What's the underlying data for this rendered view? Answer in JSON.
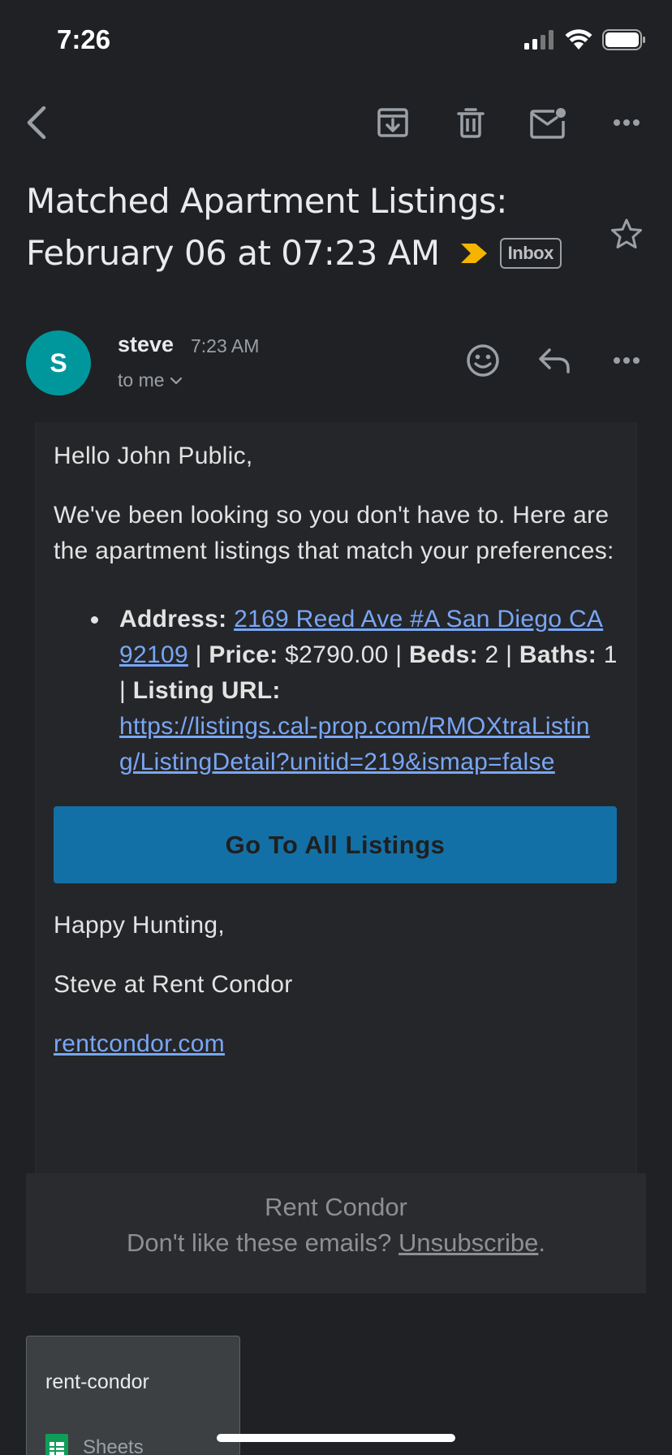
{
  "status": {
    "time": "7:26"
  },
  "subject": {
    "line1": "Matched Apartment Listings:",
    "line2": "February 06 at 07:23 AM",
    "label": "Inbox"
  },
  "sender": {
    "initial": "S",
    "name": "steve",
    "time": "7:23 AM",
    "to": "to me"
  },
  "body": {
    "greeting": "Hello John Public,",
    "intro": "We've been looking so you don't have to. Here are the apartment listings that match your preferences:",
    "listing": {
      "address_label": "Address:",
      "address": "2169 Reed Ave #A San Diego CA 92109",
      "sep": " | ",
      "price_label": "Price:",
      "price": "$2790.00",
      "beds_label": "Beds:",
      "beds": "2",
      "baths_label": "Baths:",
      "baths": "1",
      "url_label": "Listing URL:",
      "url": "https://listings.cal-prop.com/RMOXtraListing/ListingDetail?unitid=219&ismap=false"
    },
    "cta": "Go To All Listings",
    "signoff": "Happy Hunting,",
    "signature": "Steve at Rent Condor",
    "site_link": "rentcondor.com"
  },
  "footer": {
    "brand": "Rent Condor",
    "unsub_prefix": "Don't like these emails? ",
    "unsub_link": "Unsubscribe",
    "unsub_suffix": "."
  },
  "attachment": {
    "name": "rent-condor",
    "type": "Sheets"
  },
  "colors": {
    "background": "#202124",
    "avatar": "#00979c",
    "link": "#79a6f5",
    "cta": "#1370a6",
    "label_chevron": "#f4b400"
  },
  "icons": [
    "back-arrow-icon",
    "archive-icon",
    "trash-icon",
    "mark-unread-icon",
    "more-icon",
    "star-icon",
    "emoji-icon",
    "reply-icon",
    "sheets-icon",
    "chevron-down-icon"
  ]
}
